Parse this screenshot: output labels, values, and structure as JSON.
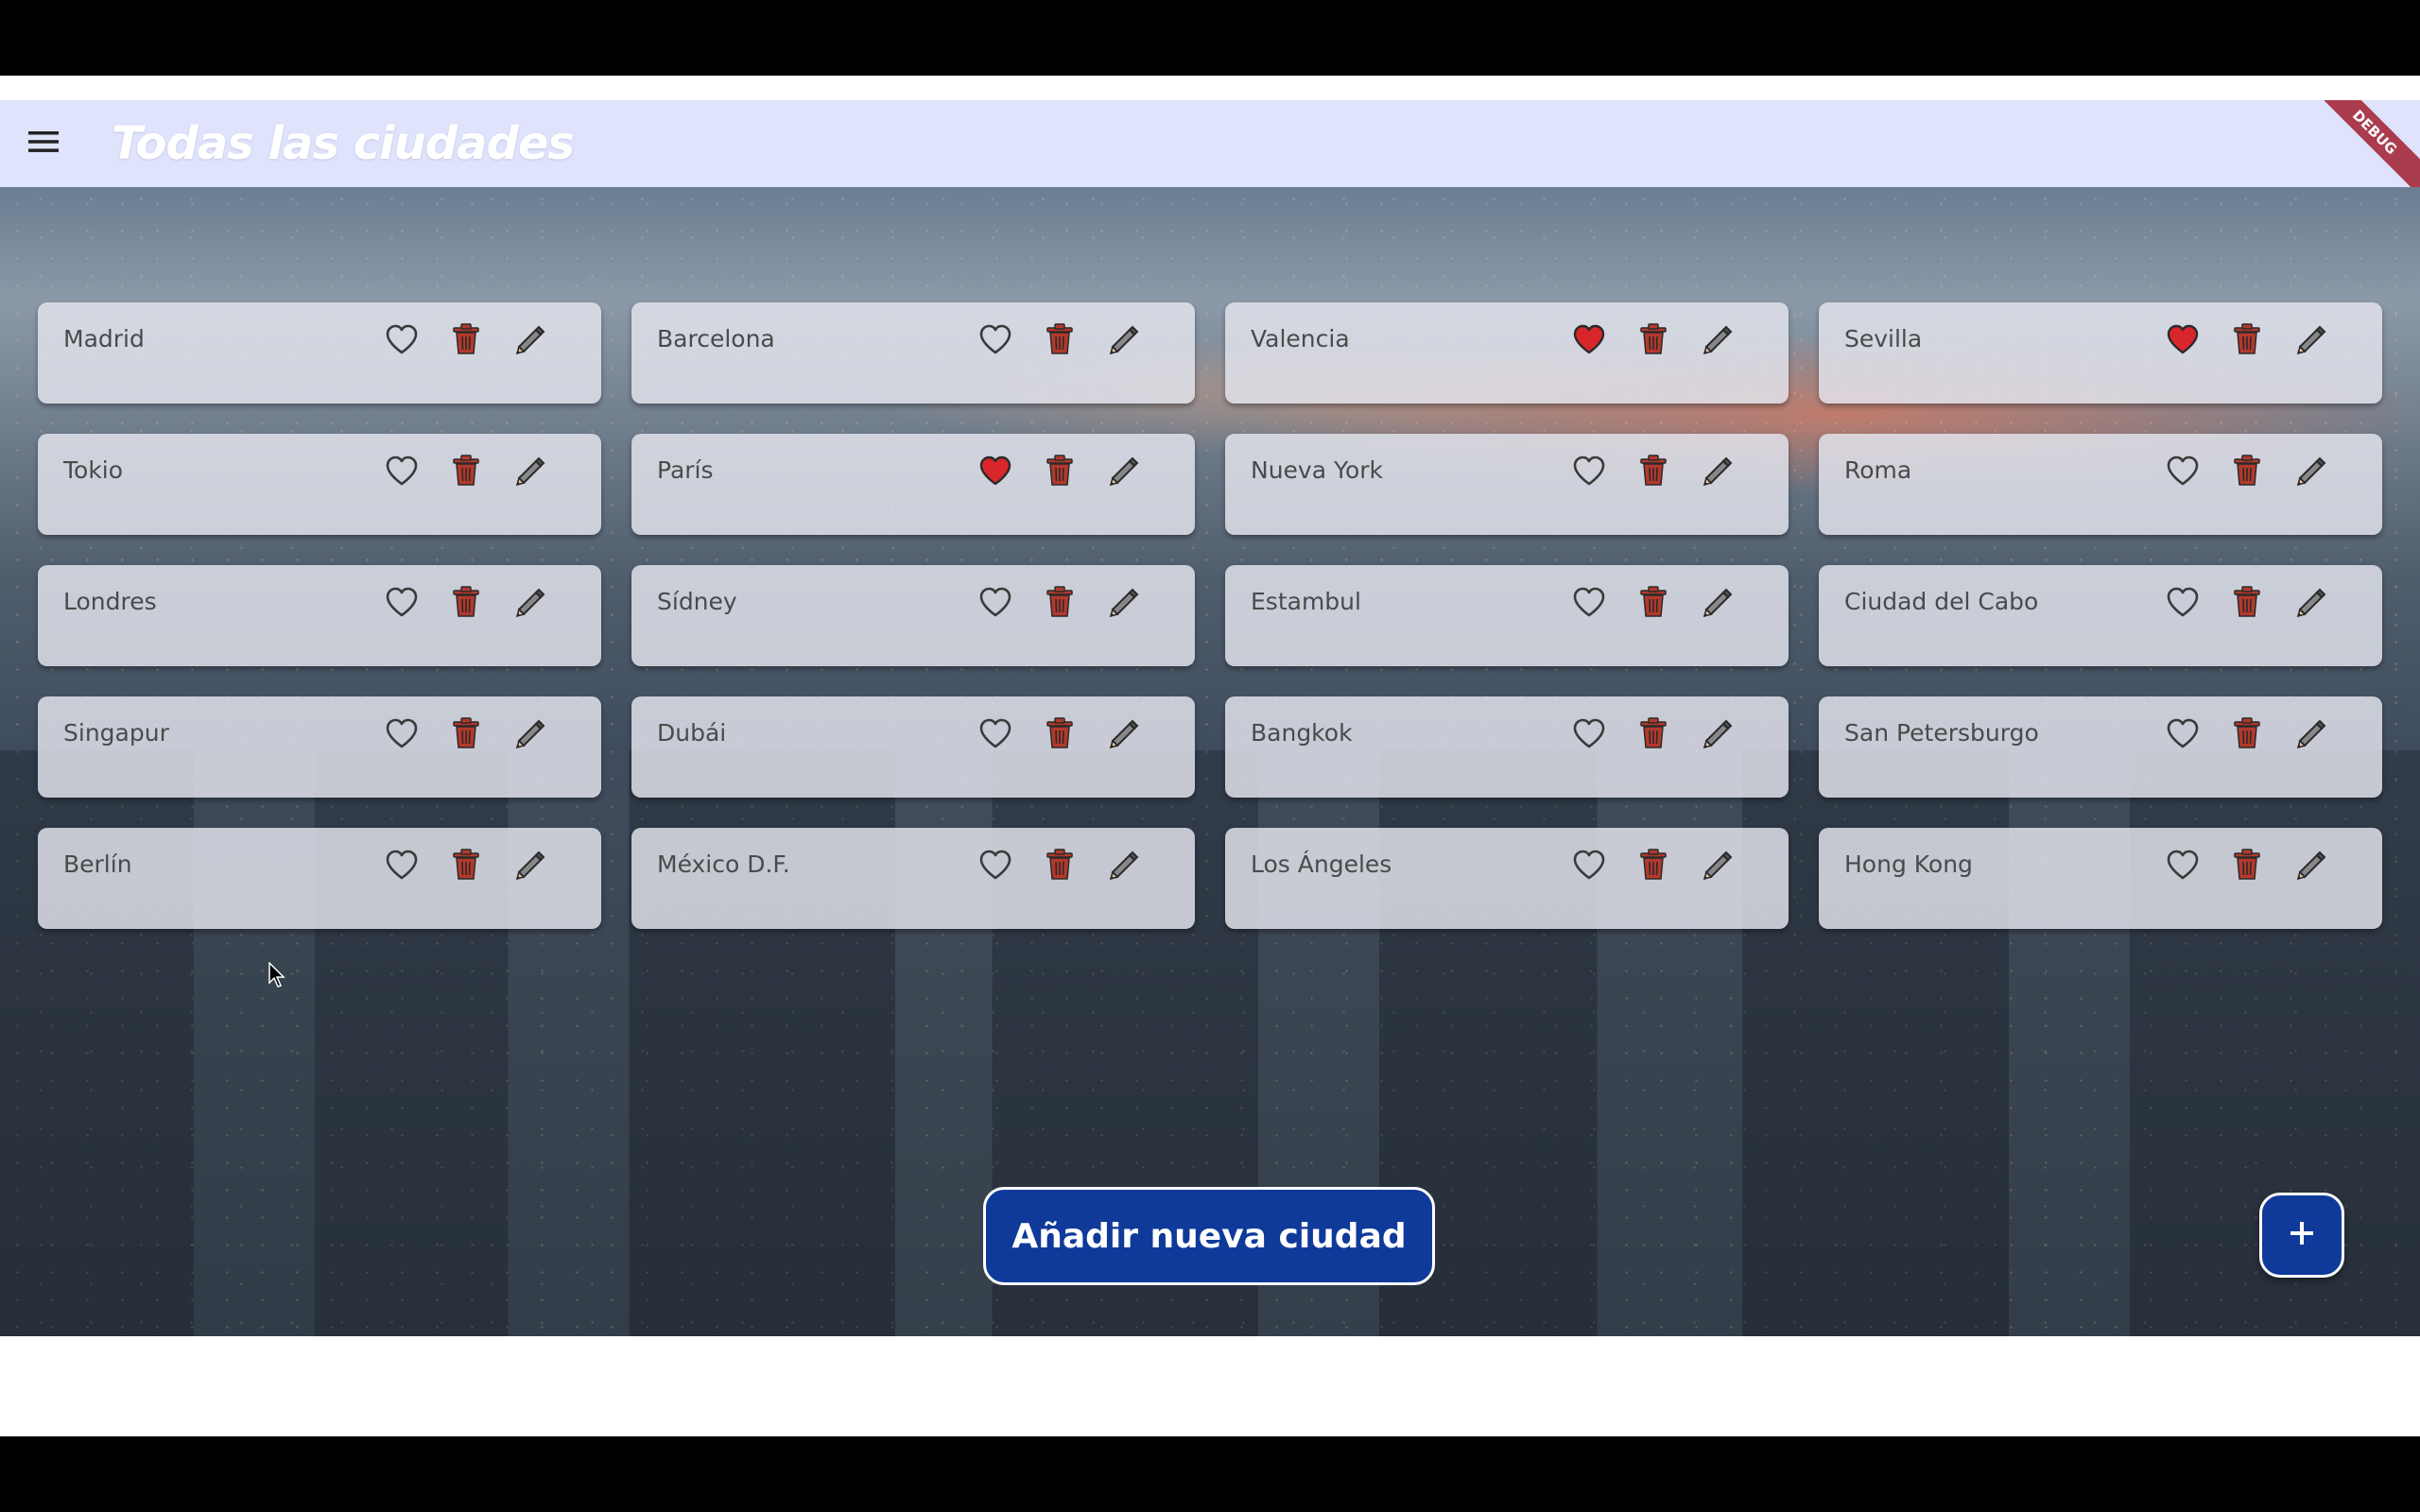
{
  "appbar": {
    "title": "Todas las ciudades",
    "menu_icon": "hamburger-menu-icon",
    "debug_banner": "DEBUG"
  },
  "colors": {
    "appbar_bg": "#dfe3fb",
    "card_bg": "rgba(226,228,236,0.84)",
    "favorite_active": "#d9262b",
    "delete_icon": "#b4382c",
    "button_primary": "#0f3a9a"
  },
  "cities": [
    {
      "name": "Madrid",
      "favorite": false
    },
    {
      "name": "Barcelona",
      "favorite": false
    },
    {
      "name": "Valencia",
      "favorite": true
    },
    {
      "name": "Sevilla",
      "favorite": true
    },
    {
      "name": "Tokio",
      "favorite": false
    },
    {
      "name": "París",
      "favorite": true
    },
    {
      "name": "Nueva York",
      "favorite": false
    },
    {
      "name": "Roma",
      "favorite": false
    },
    {
      "name": "Londres",
      "favorite": false
    },
    {
      "name": "Sídney",
      "favorite": false
    },
    {
      "name": "Estambul",
      "favorite": false
    },
    {
      "name": "Ciudad del Cabo",
      "favorite": false
    },
    {
      "name": "Singapur",
      "favorite": false
    },
    {
      "name": "Dubái",
      "favorite": false
    },
    {
      "name": "Bangkok",
      "favorite": false
    },
    {
      "name": "San Petersburgo",
      "favorite": false
    },
    {
      "name": "Berlín",
      "favorite": false
    },
    {
      "name": "México D.F.",
      "favorite": false
    },
    {
      "name": "Los Ángeles",
      "favorite": false
    },
    {
      "name": "Hong Kong",
      "favorite": false
    }
  ],
  "card_icons": [
    "heart-icon",
    "trash-icon",
    "pencil-icon"
  ],
  "actions": {
    "add_city_label": "Añadir nueva ciudad",
    "fab_icon": "plus-icon"
  }
}
